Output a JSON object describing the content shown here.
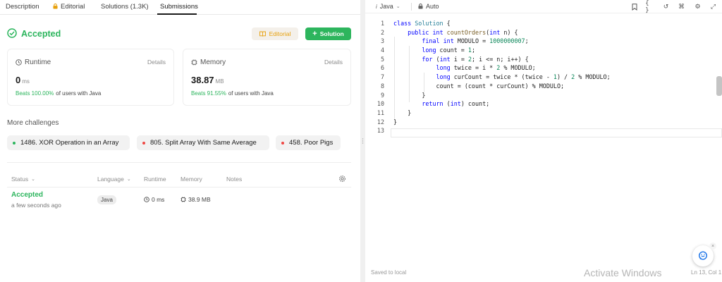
{
  "tabs": {
    "description": "Description",
    "editorial": "Editorial",
    "solutions": "Solutions (1.3K)",
    "submissions": "Submissions"
  },
  "result": {
    "status": "Accepted",
    "editorial_button": "Editorial",
    "solution_button": "Solution"
  },
  "runtime": {
    "title": "Runtime",
    "details": "Details",
    "value": "0",
    "unit": "ms",
    "beats_pct": "Beats 100.00%",
    "beats_text": "of users with Java"
  },
  "memory": {
    "title": "Memory",
    "details": "Details",
    "value": "38.87",
    "unit": "MB",
    "beats_pct": "Beats 91.55%",
    "beats_text": "of users with Java"
  },
  "more_challenges": {
    "title": "More challenges",
    "items": [
      {
        "label": "1486. XOR Operation in an Array",
        "color": "#2cb55d"
      },
      {
        "label": "805. Split Array With Same Average",
        "color": "#ef4743"
      },
      {
        "label": "458. Poor Pigs",
        "color": "#ef4743"
      }
    ]
  },
  "table": {
    "headers": {
      "status": "Status",
      "language": "Language",
      "runtime": "Runtime",
      "memory": "Memory",
      "notes": "Notes"
    },
    "rows": [
      {
        "status": "Accepted",
        "time": "a few seconds ago",
        "language": "Java",
        "runtime": "0 ms",
        "memory": "38.9 MB"
      }
    ]
  },
  "editor": {
    "language": "Java",
    "mode": "Auto",
    "lines": [
      "class Solution {",
      "    public int countOrders(int n) {",
      "        final int MODULO = 1000000007;",
      "        long count = 1;",
      "        for (int i = 2; i <= n; i++) {",
      "            long twice = i * 2 % MODULO;",
      "            long curCount = twice * (twice - 1) / 2 % MODULO;",
      "            count = (count * curCount) % MODULO;",
      "        }",
      "        return (int) count;",
      "    }",
      "}",
      ""
    ],
    "line_numbers": [
      "1",
      "2",
      "3",
      "4",
      "5",
      "6",
      "7",
      "8",
      "9",
      "10",
      "11",
      "12",
      "13"
    ],
    "saved": "Saved to local",
    "position": "Ln 13, Col 1",
    "watermark": "Activate Windows"
  },
  "colors": {
    "accent_green": "#2cb55d",
    "accent_orange": "#e7a00b",
    "difficulty_hard": "#ef4743"
  }
}
